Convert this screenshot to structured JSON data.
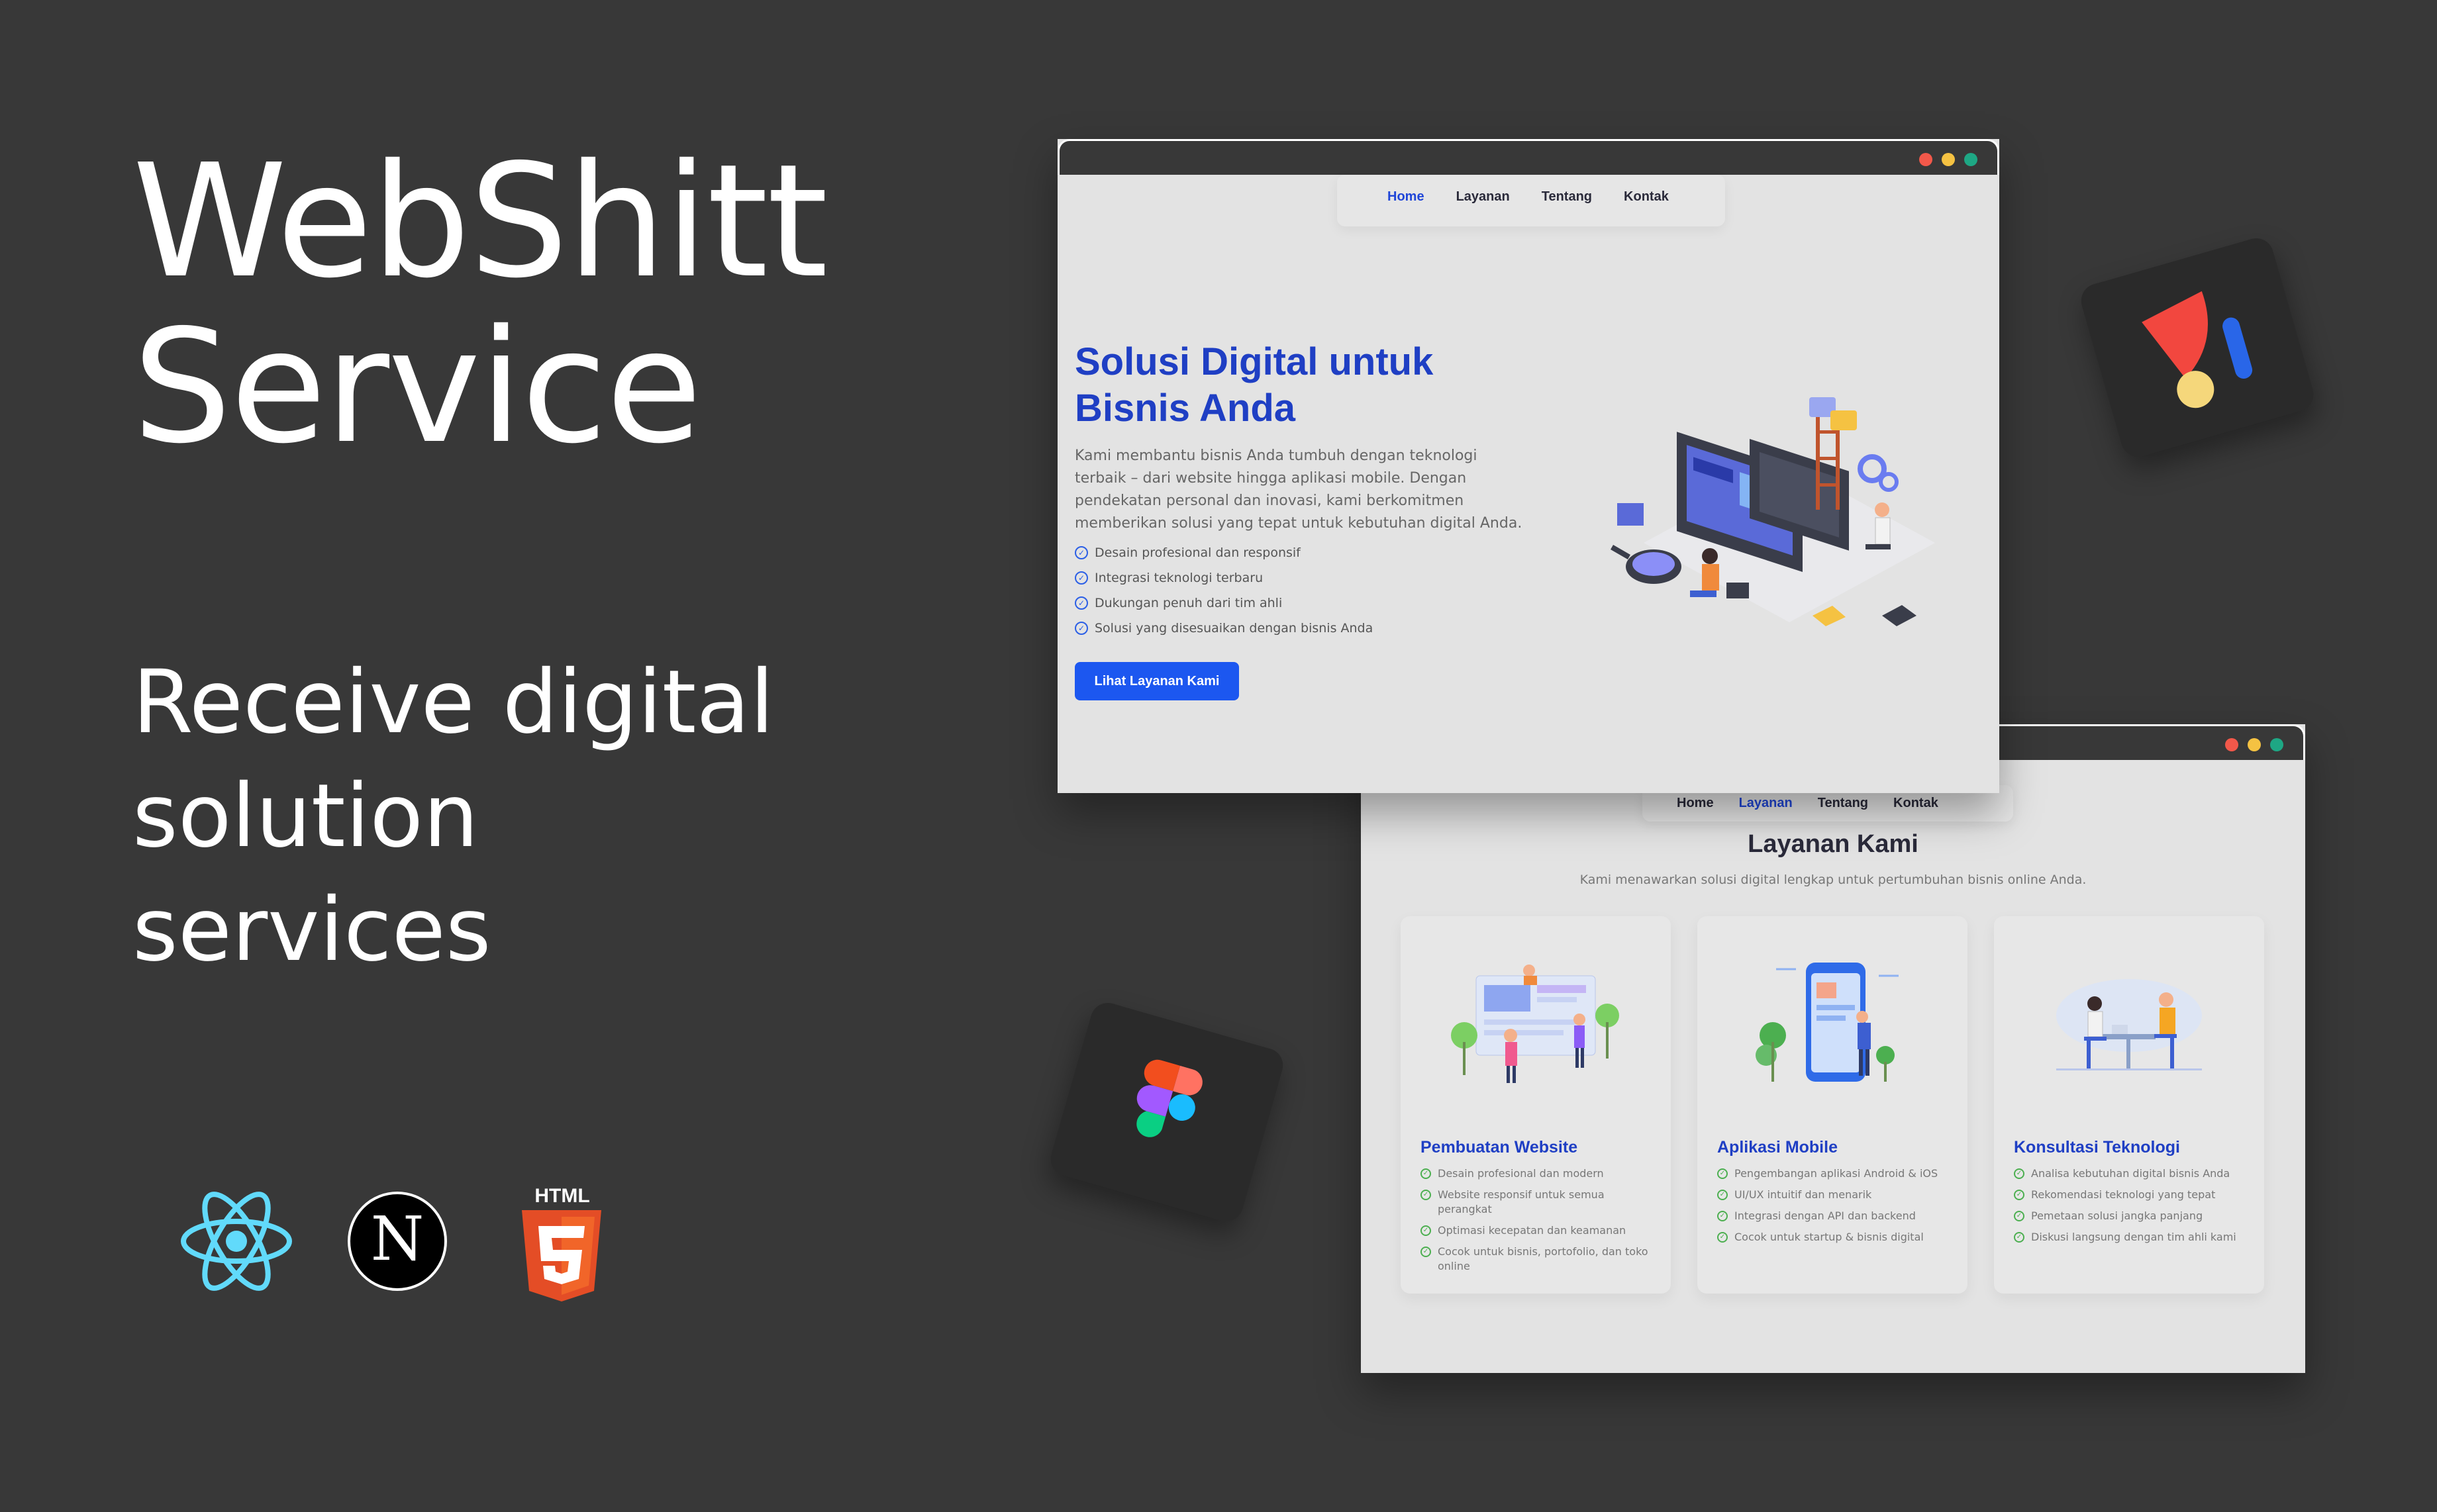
{
  "hero": {
    "title_line1": "WebShitt",
    "title_line2": "Service",
    "subtitle_line1": "Receive digital",
    "subtitle_line2": "solution",
    "subtitle_line3": "services"
  },
  "tech_icons": [
    "react-icon",
    "nextjs-icon",
    "html5-icon"
  ],
  "html5_label": "HTML",
  "nextjs_letter": "N",
  "float_logos": [
    "figma-icon",
    "abstract-app-icon"
  ],
  "window_dots": [
    "#f2584a",
    "#f5c242",
    "#1ea784"
  ],
  "landing_window": {
    "nav": [
      {
        "label": "Home",
        "active": true
      },
      {
        "label": "Layanan",
        "active": false
      },
      {
        "label": "Tentang",
        "active": false
      },
      {
        "label": "Kontak",
        "active": false
      }
    ],
    "title": "Solusi Digital untuk Bisnis Anda",
    "description": "Kami membantu bisnis Anda tumbuh dengan teknologi terbaik – dari website hingga aplikasi mobile. Dengan pendekatan personal dan inovasi, kami berkomitmen memberikan solusi yang tepat untuk kebutuhan digital Anda.",
    "features": [
      "Desain profesional dan responsif",
      "Integrasi teknologi terbaru",
      "Dukungan penuh dari tim ahli",
      "Solusi yang disesuaikan dengan bisnis Anda"
    ],
    "cta": "Lihat Layanan Kami",
    "illustration": "developer-workspace-illustration"
  },
  "services_window": {
    "nav": [
      {
        "label": "Home",
        "active": false
      },
      {
        "label": "Layanan",
        "active": true
      },
      {
        "label": "Tentang",
        "active": false
      },
      {
        "label": "Kontak",
        "active": false
      }
    ],
    "title": "Layanan Kami",
    "subtitle": "Kami menawarkan solusi digital lengkap untuk pertumbuhan bisnis online Anda.",
    "cards": [
      {
        "title": "Pembuatan Website",
        "illustration": "website-building-illustration",
        "items": [
          "Desain profesional dan modern",
          "Website responsif untuk semua perangkat",
          "Optimasi kecepatan dan keamanan",
          "Cocok untuk bisnis, portofolio, dan toko online"
        ]
      },
      {
        "title": "Aplikasi Mobile",
        "illustration": "mobile-app-illustration",
        "items": [
          "Pengembangan aplikasi Android & iOS",
          "UI/UX intuitif dan menarik",
          "Integrasi dengan API dan backend",
          "Cocok untuk startup & bisnis digital"
        ]
      },
      {
        "title": "Konsultasi Teknologi",
        "illustration": "consultation-illustration",
        "items": [
          "Analisa kebutuhan digital bisnis Anda",
          "Rekomendasi teknologi yang tepat",
          "Pemetaan solusi jangka panjang",
          "Diskusi langsung dengan tim ahli kami"
        ]
      }
    ]
  }
}
